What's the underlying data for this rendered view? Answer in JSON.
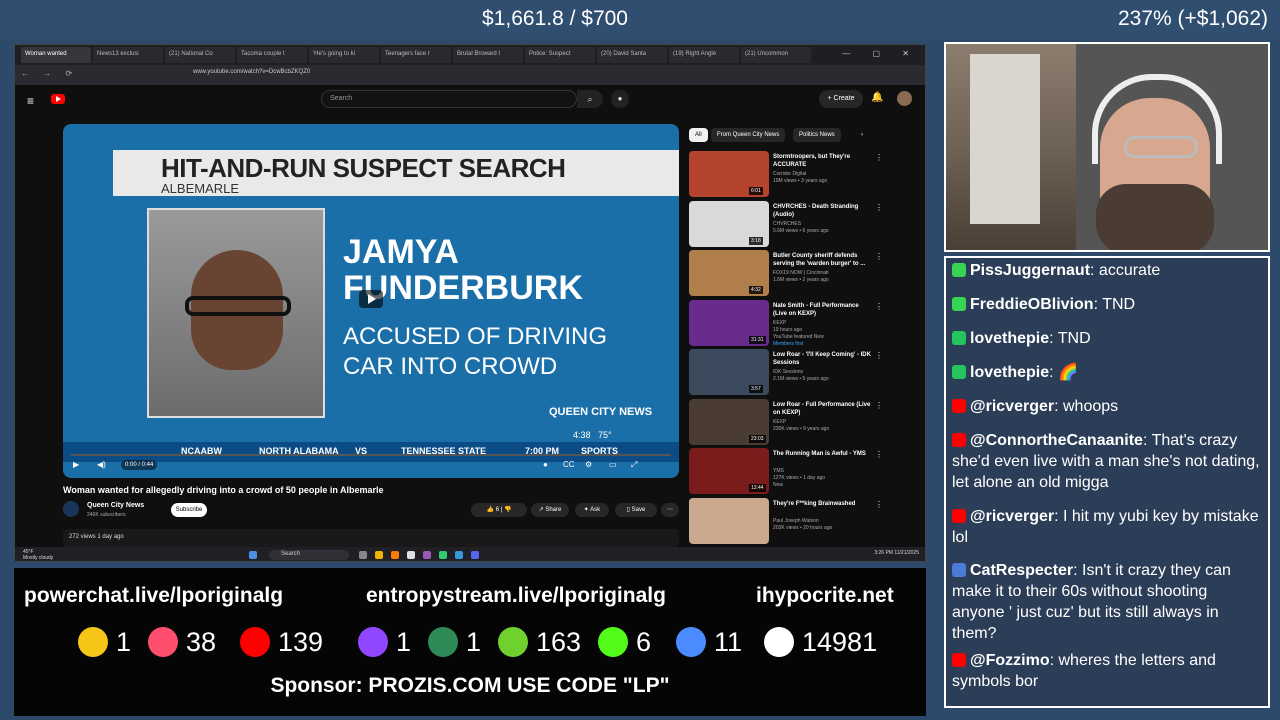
{
  "stream": {
    "money": "$1,661.8 / $700",
    "percent": "237% (+$1,062)"
  },
  "browser": {
    "tabs": [
      "Woman wanted",
      "News13 exclusi",
      "(21) National Co",
      "Tacoma couple t",
      "'He's going to ki",
      "Teenagers face r",
      "Brutal Broward I",
      "Police: Suspect",
      "(20) David Santa",
      "(19) Right Angle",
      "(21) Uncommon"
    ],
    "url": "www.youtube.com/watch?v=DcwBcbZKQZ0"
  },
  "youtube": {
    "search_placeholder": "Search",
    "create_label": "Create",
    "video": {
      "banner_title": "HIT-AND-RUN SUSPECT SEARCH",
      "banner_sub": "ALBEMARLE",
      "name": "JAMYA FUNDERBURK",
      "accused": "ACCUSED OF DRIVING CAR INTO CROWD",
      "station": "QUEEN CITY NEWS",
      "bug_time": "4:38",
      "bug_temp": "75°",
      "ticker": [
        "NCAABW",
        "NORTH ALABAMA",
        "VS",
        "TENNESSEE STATE",
        "7:00 PM",
        "SPORTS"
      ],
      "time": "0:00 / 0:44"
    },
    "title": "Woman wanted for allegedly driving into a crowd of 50 people in Albemarle",
    "channel": "Queen City News",
    "subscribers": "246K subscribers",
    "subscribe": "Subscribe",
    "likes": "6",
    "share": "Share",
    "ask": "Ask",
    "save": "Save",
    "views": "272 views  1 day ago",
    "chips": [
      "All",
      "From Queen City News",
      "Politics News"
    ],
    "recs": [
      {
        "title": "Stormtroopers, but They're ACCURATE",
        "channel": "Corridor Digital",
        "meta": "19M views • 3 years ago",
        "dur": "6:01",
        "color": "#b5442e"
      },
      {
        "title": "CHVRCHES - Death Stranding (Audio)",
        "channel": "CHVRCHES",
        "meta": "5.6M views • 6 years ago",
        "dur": "3:18",
        "color": "#d9d9d9"
      },
      {
        "title": "Butler County sheriff defends serving the 'warden burger' to ...",
        "channel": "FOX19 NOW | Cincinnati",
        "meta": "1.6M views • 2 years ago",
        "dur": "4:32",
        "color": "#b07e4a"
      },
      {
        "title": "Nate Smith - Full Performance (Live on KEXP)",
        "channel": "KEXP",
        "meta": "19 hours ago",
        "extra": "YouTube featured  New",
        "extra2": "Members first",
        "dur": "31:31",
        "color": "#6a2c8c"
      },
      {
        "title": "Low Roar - 'I'll Keep Coming' - IDK Sessions",
        "channel": "IDK Sessions",
        "meta": "2.1M views • 5 years ago",
        "dur": "3:57",
        "color": "#3b4a5c"
      },
      {
        "title": "Low Roar - Full Performance (Live on KEXP)",
        "channel": "KEXP",
        "meta": "230K views • 9 years ago",
        "dur": "23:03",
        "color": "#4a3b33"
      },
      {
        "title": "The Running Man is Awful - YMS",
        "channel": "YMS",
        "meta": "127K views • 1 day ago",
        "extra": "New",
        "dur": "13:44",
        "color": "#7a1c1c"
      },
      {
        "title": "They're F**king Brainwashed",
        "channel": "Paul Joseph Watson",
        "meta": "203K views • 20 hours ago",
        "dur": "",
        "color": "#c9a88e"
      }
    ]
  },
  "taskbar": {
    "search": "Search",
    "weather": "45°F",
    "weather2": "Mostly cloudy",
    "time": "3:26 PM",
    "date": "11/21/2025"
  },
  "chat": [
    {
      "user": "PissJuggernaut",
      "text": "accurate",
      "color": "#39d353"
    },
    {
      "user": "FreddieOBlivion",
      "text": "TND",
      "color": "#39d353"
    },
    {
      "user": "lovethepie",
      "text": "TND",
      "color": "#22c55e"
    },
    {
      "user": "lovethepie",
      "text": "🌈",
      "color": "#22c55e"
    },
    {
      "user": "@ricverger",
      "text": "whoops",
      "color": "#ff0000"
    },
    {
      "user": "@ConnortheCanaanite",
      "text": "That's crazy she'd even live with a man she's not dating, let alone an old migga",
      "color": "#ff0000"
    },
    {
      "user": "@ricverger",
      "text": "I hit my yubi key by mistake lol",
      "color": "#ff0000"
    },
    {
      "user": "CatRespecter",
      "text": "Isn't it crazy they can make it to their 60s without shooting anyone ' just cuz' but its still always in them?",
      "color": "#4a7bd6"
    },
    {
      "user": "@Fozzimo",
      "text": "wheres the letters and symbols bor",
      "color": "#ff0000"
    }
  ],
  "links": [
    "powerchat.live/lporiginalg",
    "entropystream.live/lporiginalg",
    "ihypocrite.net"
  ],
  "counts": [
    {
      "icon": "robot-icon",
      "value": "1",
      "color": "#f5c518"
    },
    {
      "icon": "pinwheel-icon",
      "value": "38",
      "color": "#ff4d6d"
    },
    {
      "icon": "youtube-icon",
      "value": "139",
      "color": "#ff0000"
    },
    {
      "icon": "twitch-icon",
      "value": "1",
      "color": "#9146ff"
    },
    {
      "icon": "orb-icon",
      "value": "1",
      "color": "#2e8b57"
    },
    {
      "icon": "rumble-icon",
      "value": "163",
      "color": "#6fd12d"
    },
    {
      "icon": "kick-icon",
      "value": "6",
      "color": "#53fc18"
    },
    {
      "icon": "moon-icon",
      "value": "11",
      "color": "#4a8cff"
    },
    {
      "icon": "x-icon",
      "value": "14981",
      "color": "#ffffff"
    }
  ],
  "sponsor": "Sponsor: PROZIS.COM USE CODE \"LP\""
}
